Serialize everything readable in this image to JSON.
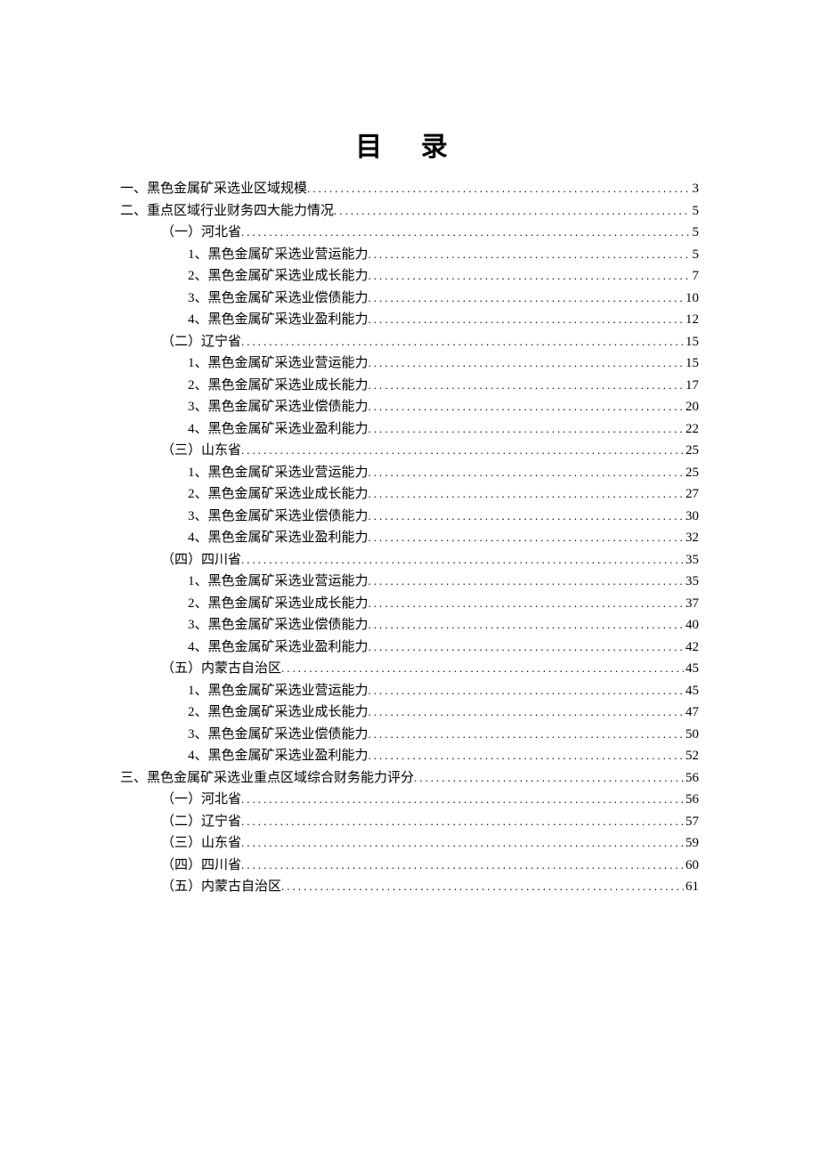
{
  "title": "目 录",
  "toc": [
    {
      "indent": 0,
      "label": "一、黑色金属矿采选业区域规模",
      "page": "3"
    },
    {
      "indent": 0,
      "label": "二、重点区域行业财务四大能力情况",
      "page": "5"
    },
    {
      "indent": 1,
      "label": "（一）河北省",
      "page": "5"
    },
    {
      "indent": 2,
      "label": "1、黑色金属矿采选业营运能力",
      "page": "5"
    },
    {
      "indent": 2,
      "label": "2、黑色金属矿采选业成长能力",
      "page": "7"
    },
    {
      "indent": 2,
      "label": "3、黑色金属矿采选业偿债能力",
      "page": "10"
    },
    {
      "indent": 2,
      "label": "4、黑色金属矿采选业盈利能力",
      "page": "12"
    },
    {
      "indent": 1,
      "label": "（二）辽宁省",
      "page": "15"
    },
    {
      "indent": 2,
      "label": "1、黑色金属矿采选业营运能力",
      "page": "15"
    },
    {
      "indent": 2,
      "label": "2、黑色金属矿采选业成长能力",
      "page": "17"
    },
    {
      "indent": 2,
      "label": "3、黑色金属矿采选业偿债能力",
      "page": "20"
    },
    {
      "indent": 2,
      "label": "4、黑色金属矿采选业盈利能力",
      "page": "22"
    },
    {
      "indent": 1,
      "label": "（三）山东省",
      "page": "25"
    },
    {
      "indent": 2,
      "label": "1、黑色金属矿采选业营运能力",
      "page": "25"
    },
    {
      "indent": 2,
      "label": "2、黑色金属矿采选业成长能力",
      "page": "27"
    },
    {
      "indent": 2,
      "label": "3、黑色金属矿采选业偿债能力",
      "page": "30"
    },
    {
      "indent": 2,
      "label": "4、黑色金属矿采选业盈利能力",
      "page": "32"
    },
    {
      "indent": 1,
      "label": "（四）四川省",
      "page": "35"
    },
    {
      "indent": 2,
      "label": "1、黑色金属矿采选业营运能力",
      "page": "35"
    },
    {
      "indent": 2,
      "label": "2、黑色金属矿采选业成长能力",
      "page": "37"
    },
    {
      "indent": 2,
      "label": "3、黑色金属矿采选业偿债能力",
      "page": "40"
    },
    {
      "indent": 2,
      "label": "4、黑色金属矿采选业盈利能力",
      "page": "42"
    },
    {
      "indent": 1,
      "label": "（五）内蒙古自治区",
      "page": "45"
    },
    {
      "indent": 2,
      "label": "1、黑色金属矿采选业营运能力",
      "page": "45"
    },
    {
      "indent": 2,
      "label": "2、黑色金属矿采选业成长能力",
      "page": "47"
    },
    {
      "indent": 2,
      "label": "3、黑色金属矿采选业偿债能力",
      "page": "50"
    },
    {
      "indent": 2,
      "label": "4、黑色金属矿采选业盈利能力",
      "page": "52"
    },
    {
      "indent": 0,
      "label": "三、黑色金属矿采选业重点区域综合财务能力评分",
      "page": "56"
    },
    {
      "indent": 1,
      "label": "（一）河北省",
      "page": "56"
    },
    {
      "indent": 1,
      "label": "（二）辽宁省",
      "page": "57"
    },
    {
      "indent": 1,
      "label": "（三）山东省",
      "page": "59"
    },
    {
      "indent": 1,
      "label": "（四）四川省",
      "page": "60"
    },
    {
      "indent": 1,
      "label": "（五）内蒙古自治区",
      "page": "61"
    }
  ]
}
